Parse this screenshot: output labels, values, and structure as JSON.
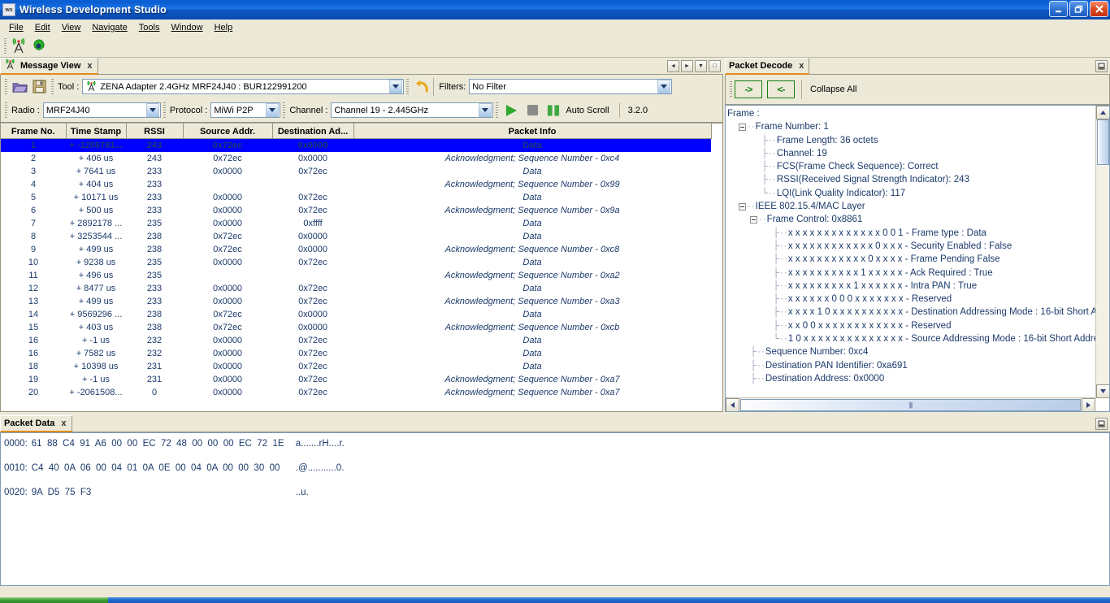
{
  "window": {
    "title": "Wireless Development Studio",
    "app_icon": "ws",
    "minimize": "minimize-icon",
    "maximize": "restore-icon",
    "close": "close-icon"
  },
  "menubar": {
    "items": [
      "File",
      "Edit",
      "View",
      "Navigate",
      "Tools",
      "Window",
      "Help"
    ]
  },
  "toolbar": {
    "icons": [
      "antenna-icon",
      "gear-icon"
    ]
  },
  "message_view": {
    "tab_label": "Message View",
    "tab_icon": "antenna-icon",
    "tab_close": "x",
    "nav": {
      "prev": "◄",
      "next": "►",
      "dropdown": "▼",
      "maximize": "□"
    },
    "open_icon": "folder-open-icon",
    "save_icon": "save-icon",
    "tool_label": "Tool :",
    "tool_value": "ZENA Adapter 2.4GHz MRF24J40  :  BUR122991200",
    "refresh_icon": "undo-icon",
    "filters_label": "Filters:",
    "filters_value": "No Filter",
    "radio_label": "Radio :",
    "radio_value": "MRF24J40",
    "protocol_label": "Protocol :",
    "protocol_value": "MiWi P2P",
    "channel_label": "Channel :",
    "channel_value": "Channel 19 - 2.445GHz",
    "play_icon": "play-icon",
    "stop_icon": "stop-icon",
    "pause_icon": "pause-icon",
    "auto_scroll_label": "Auto Scroll",
    "version": "3.2.0"
  },
  "table": {
    "columns": [
      "Frame No.",
      "Time Stamp",
      "RSSI",
      "Source Addr.",
      "Destination Ad...",
      "Packet Info"
    ],
    "rows": [
      {
        "no": "1",
        "ts": "+ -1208781...",
        "rssi": "243",
        "src": "0x72ec",
        "dst": "0x0000",
        "info": "Data",
        "style": "sel"
      },
      {
        "no": "2",
        "ts": "+ 406 us",
        "rssi": "243",
        "src": "0x72ec",
        "dst": "0x0000",
        "info": "Acknowledgment; Sequence Number - 0xc4",
        "style": "alt"
      },
      {
        "no": "3",
        "ts": "+ 7641 us",
        "rssi": "233",
        "src": "0x0000",
        "dst": "0x72ec",
        "info": "Data",
        "style": "norm"
      },
      {
        "no": "4",
        "ts": "+ 404 us",
        "rssi": "233",
        "src": "",
        "dst": "",
        "info": "Acknowledgment; Sequence Number - 0x99",
        "style": "alt"
      },
      {
        "no": "5",
        "ts": "+ 10171 us",
        "rssi": "233",
        "src": "0x0000",
        "dst": "0x72ec",
        "info": "Data",
        "style": "norm"
      },
      {
        "no": "6",
        "ts": "+ 500 us",
        "rssi": "233",
        "src": "0x0000",
        "dst": "0x72ec",
        "info": "Acknowledgment; Sequence Number - 0x9a",
        "style": "alt"
      },
      {
        "no": "7",
        "ts": "+ 2892178 ...",
        "rssi": "235",
        "src": "0x0000",
        "dst": "0xffff",
        "info": "Data",
        "style": "norm"
      },
      {
        "no": "8",
        "ts": "+ 3253544 ...",
        "rssi": "238",
        "src": "0x72ec",
        "dst": "0x0000",
        "info": "Data",
        "style": "norm"
      },
      {
        "no": "9",
        "ts": "+ 499 us",
        "rssi": "238",
        "src": "0x72ec",
        "dst": "0x0000",
        "info": "Acknowledgment; Sequence Number - 0xc8",
        "style": "alt"
      },
      {
        "no": "10",
        "ts": "+ 9238 us",
        "rssi": "235",
        "src": "0x0000",
        "dst": "0x72ec",
        "info": "Data",
        "style": "norm"
      },
      {
        "no": "11",
        "ts": "+ 496 us",
        "rssi": "235",
        "src": "",
        "dst": "",
        "info": "Acknowledgment; Sequence Number - 0xa2",
        "style": "alt"
      },
      {
        "no": "12",
        "ts": "+ 8477 us",
        "rssi": "233",
        "src": "0x0000",
        "dst": "0x72ec",
        "info": "Data",
        "style": "norm"
      },
      {
        "no": "13",
        "ts": "+ 499 us",
        "rssi": "233",
        "src": "0x0000",
        "dst": "0x72ec",
        "info": "Acknowledgment; Sequence Number - 0xa3",
        "style": "alt"
      },
      {
        "no": "14",
        "ts": "+ 9569296 ...",
        "rssi": "238",
        "src": "0x72ec",
        "dst": "0x0000",
        "info": "Data",
        "style": "norm"
      },
      {
        "no": "15",
        "ts": "+ 403 us",
        "rssi": "238",
        "src": "0x72ec",
        "dst": "0x0000",
        "info": "Acknowledgment; Sequence Number - 0xcb",
        "style": "alt"
      },
      {
        "no": "16",
        "ts": "+ -1 us",
        "rssi": "232",
        "src": "0x0000",
        "dst": "0x72ec",
        "info": "Data",
        "style": "norm"
      },
      {
        "no": "16",
        "ts": "+ 7582 us",
        "rssi": "232",
        "src": "0x0000",
        "dst": "0x72ec",
        "info": "Data",
        "style": "norm"
      },
      {
        "no": "18",
        "ts": "+ 10398 us",
        "rssi": "231",
        "src": "0x0000",
        "dst": "0x72ec",
        "info": "Data",
        "style": "norm"
      },
      {
        "no": "19",
        "ts": "+ -1 us",
        "rssi": "231",
        "src": "0x0000",
        "dst": "0x72ec",
        "info": "Acknowledgment; Sequence Number - 0xa7",
        "style": "alt"
      },
      {
        "no": "20",
        "ts": "+ -2061508...",
        "rssi": "0",
        "src": "0x0000",
        "dst": "0x72ec",
        "info": "Acknowledgment; Sequence Number - 0xa7",
        "style": "alt"
      }
    ]
  },
  "packet_decode": {
    "tab_label": "Packet Decode",
    "tab_close": "x",
    "minimize_icon": "minimize-panel-icon",
    "expand_button": "->",
    "collapse_button": "<-",
    "collapse_all_label": "Collapse All",
    "tree": [
      {
        "indent": 0,
        "box": false,
        "stem": "",
        "text": "Frame :"
      },
      {
        "indent": 1,
        "box": true,
        "stem": "",
        "text": "Frame Number: 1"
      },
      {
        "indent": 3,
        "box": false,
        "stem": "leaf",
        "text": "Frame Length: 36 octets"
      },
      {
        "indent": 3,
        "box": false,
        "stem": "leaf",
        "text": "Channel: 19"
      },
      {
        "indent": 3,
        "box": false,
        "stem": "leaf",
        "text": "FCS(Frame Check Sequence): Correct"
      },
      {
        "indent": 3,
        "box": false,
        "stem": "leaf",
        "text": "RSSI(Received Signal Strength Indicator): 243"
      },
      {
        "indent": 3,
        "box": false,
        "stem": "last",
        "text": "LQI(Link Quality Indicator): 117"
      },
      {
        "indent": 1,
        "box": true,
        "stem": "",
        "text": "IEEE 802.15.4/MAC Layer"
      },
      {
        "indent": 2,
        "box": true,
        "stem": "",
        "text": "Frame Control: 0x8861"
      },
      {
        "indent": 4,
        "box": false,
        "stem": "leaf",
        "text": "x x x x  x x x x  x x x x  x 0 0 1 - Frame type : Data"
      },
      {
        "indent": 4,
        "box": false,
        "stem": "leaf",
        "text": "x x x x  x x x x  x x x x 0 x x x - Security Enabled : False"
      },
      {
        "indent": 4,
        "box": false,
        "stem": "leaf",
        "text": "x x x x  x x x x  x x x 0  x x x x - Frame Pending False"
      },
      {
        "indent": 4,
        "box": false,
        "stem": "leaf",
        "text": "x x x x  x x x x  x x 1 x  x x x x - Ack Required : True"
      },
      {
        "indent": 4,
        "box": false,
        "stem": "leaf",
        "text": "x x x x  x x x x  x 1 x x  x x x x - Intra PAN : True"
      },
      {
        "indent": 4,
        "box": false,
        "stem": "leaf",
        "text": "x x x x  x x 0 0  0 x x x  x x x x - Reserved"
      },
      {
        "indent": 4,
        "box": false,
        "stem": "leaf",
        "text": "x x x x  1 0 x x  x x x x  x x x x - Destination Addressing Mode : 16-bit Short A"
      },
      {
        "indent": 4,
        "box": false,
        "stem": "leaf",
        "text": "x x 0 0  x x x x  x x x x  x x x x - Reserved"
      },
      {
        "indent": 4,
        "box": false,
        "stem": "last",
        "text": "1 0 x x  x x x x  x x x x  x x x x - Source Addressing Mode : 16-bit Short Addre"
      },
      {
        "indent": 2,
        "box": false,
        "stem": "leaf",
        "text": "Sequence Number: 0xc4"
      },
      {
        "indent": 2,
        "box": false,
        "stem": "leaf",
        "text": "Destination PAN Identifier: 0xa691"
      },
      {
        "indent": 2,
        "box": false,
        "stem": "leaf",
        "text": "Destination Address: 0x0000"
      }
    ]
  },
  "packet_data": {
    "tab_label": "Packet Data",
    "tab_close": "x",
    "minimize_icon": "minimize-panel-icon",
    "lines": [
      {
        "offset": "0000:",
        "hex": "61  88  C4  91  A6  00  00  EC  72  48  00  00  00  EC  72  1E",
        "ascii": "a.......rH....r."
      },
      {
        "offset": "0010:",
        "hex": "C4  40  0A  06  00  04  01  0A  0E  00  04  0A  00  00  30  00",
        "ascii": ".@...........0."
      },
      {
        "offset": "0020:",
        "hex": "9A  D5  75  F3",
        "ascii": "..u."
      }
    ]
  },
  "colors": {
    "accent_orange": "#c05a14",
    "text_blue": "#1b3a6b",
    "selection": "#0000ff",
    "title_blue": "#1a73e8",
    "chrome": "#ece9d8",
    "progress_green": "#3f9d35"
  }
}
